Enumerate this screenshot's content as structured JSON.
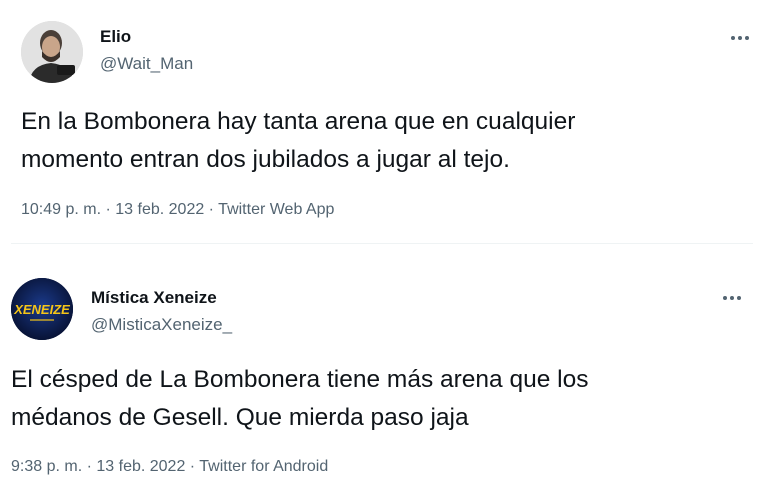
{
  "tweets": [
    {
      "name": "Elio",
      "handle": "@Wait_Man",
      "text_lines": [
        "En la Bombonera hay tanta arena que en cualquier",
        "momento entran dos jubilados a jugar al tejo."
      ],
      "time": "10:49 p. m.",
      "date": "13 feb. 2022",
      "source": "Twitter Web App",
      "separator": " · "
    },
    {
      "name": "Mística Xeneize",
      "handle": "@MisticaXeneize_",
      "avatar_text": "XENEIZE",
      "text_lines": [
        "El césped de La Bombonera tiene más arena que los",
        "médanos de Gesell. Que mierda paso jaja"
      ],
      "time": "9:38 p. m.",
      "date": "13 feb. 2022",
      "source": "Twitter for Android",
      "separator": " · "
    }
  ],
  "colors": {
    "primary_text": "#0f1419",
    "secondary_text": "#536471",
    "divider": "#eff3f4",
    "avatar2_bg": "#0a1a44",
    "avatar2_text": "#f5c518"
  },
  "icons": {
    "more": "more-dots-icon"
  }
}
